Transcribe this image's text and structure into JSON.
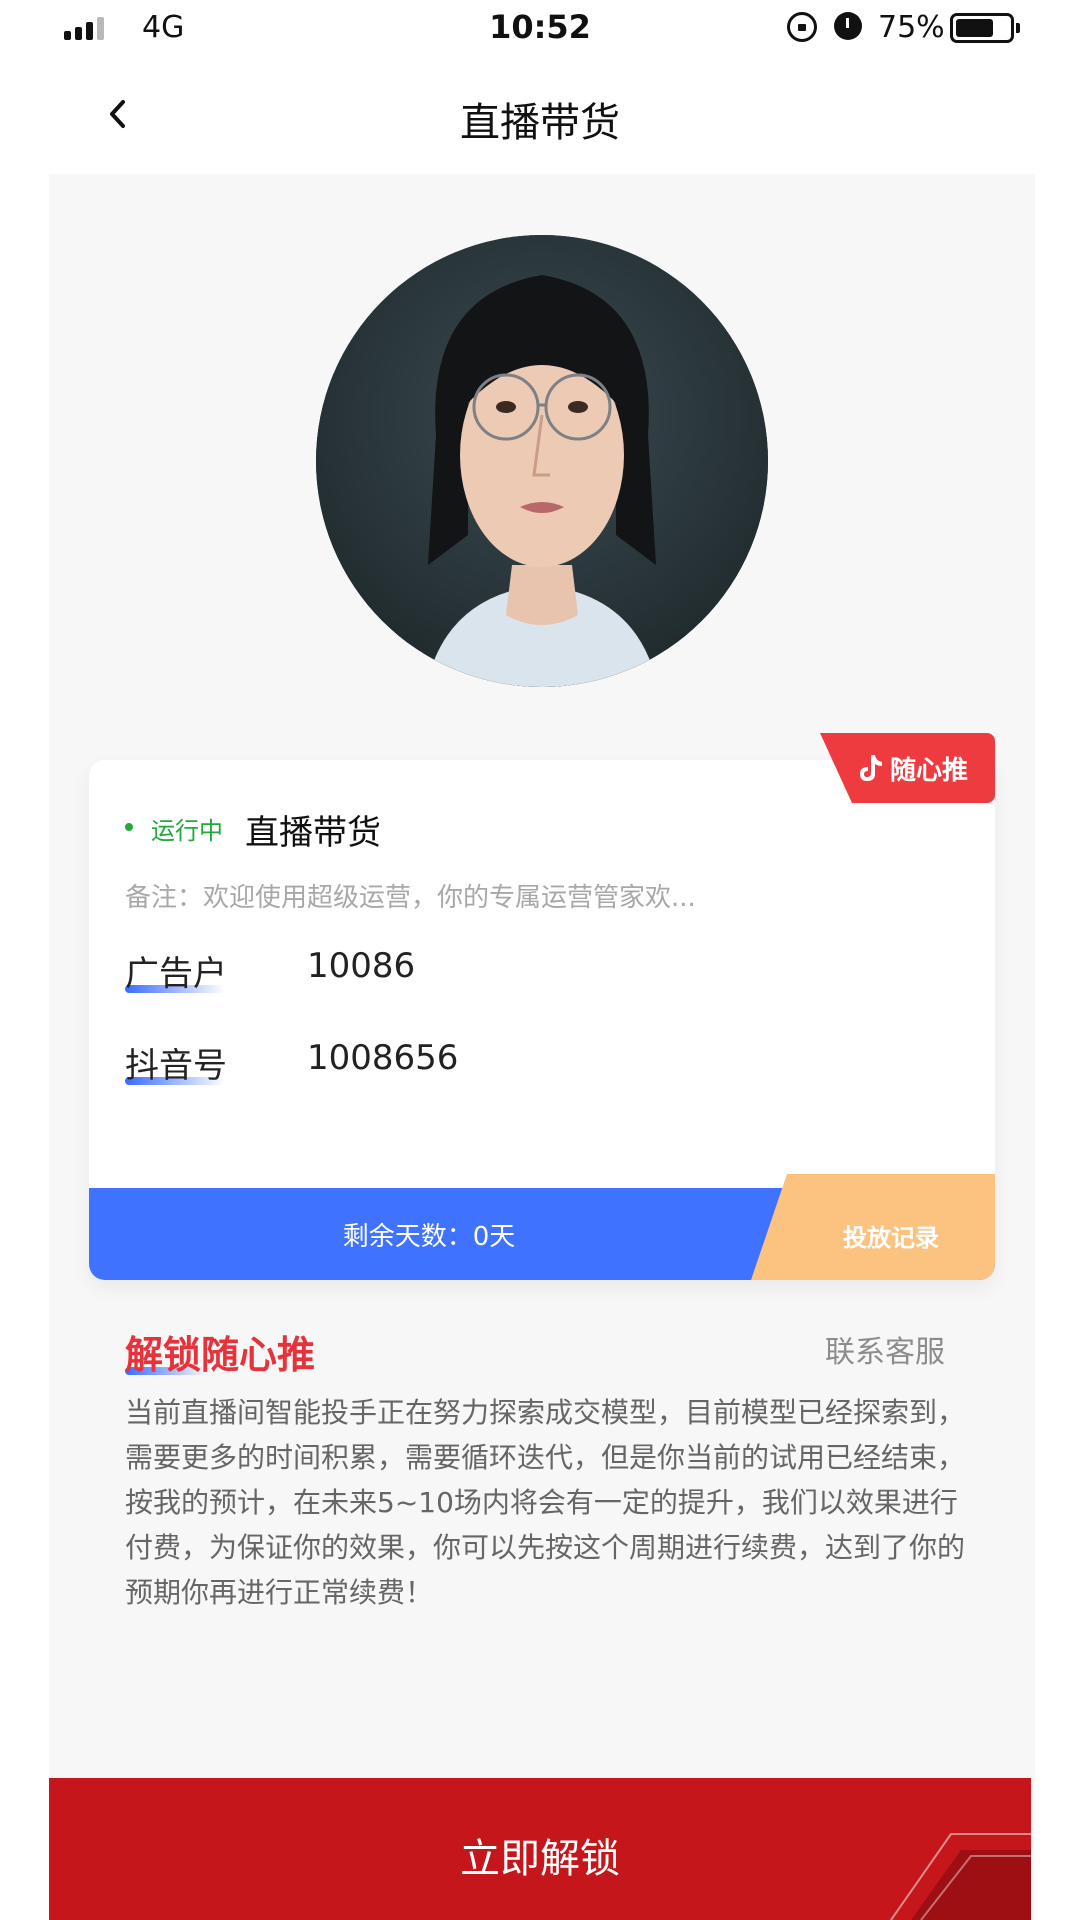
{
  "status_bar": {
    "network": "4G",
    "time": "10:52",
    "battery": "75%"
  },
  "nav": {
    "title": "直播带货"
  },
  "card": {
    "tag_label": "随心推",
    "status": "运行中",
    "title": "直播带货",
    "note": "备注：欢迎使用超级运营，你的专属运营管家欢...",
    "rows": [
      {
        "label": "广告户",
        "value": "10086"
      },
      {
        "label": "抖音号",
        "value": "1008656"
      }
    ],
    "days_left": "剩余天数：0天",
    "record_label": "投放记录"
  },
  "section": {
    "title": "解锁随心推",
    "contact": "联系客服",
    "description": "当前直播间智能投手正在努力探索成交模型，目前模型已经探索到，需要更多的时间积累，需要循环迭代，但是你当前的试用已经结束，按我的预计，在未来5~10场内将会有一定的提升，我们以效果进行付费，为保证你的效果，你可以先按这个周期进行续费，达到了你的预期你再进行正常续费！"
  },
  "unlock_button": "立即解锁",
  "colors": {
    "accent_red": "#c4161b",
    "accent_blue": "#3e72ff",
    "status_green": "#22a93a",
    "record_orange": "#fcc27f"
  },
  "icons": [
    "back-arrow-icon",
    "douyin-icon",
    "rotation-lock-icon",
    "alarm-icon",
    "battery-icon",
    "signal-icon"
  ]
}
